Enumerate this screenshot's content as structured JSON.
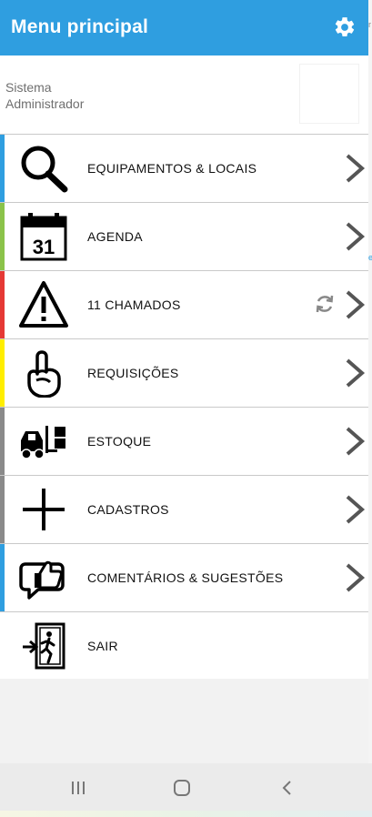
{
  "header": {
    "title": "Menu principal",
    "settings_icon": "gear-icon",
    "color": "#2f9ee0"
  },
  "user": {
    "line1": "Sistema",
    "line2": "Administrador"
  },
  "side_fragments": [
    "r",
    "e"
  ],
  "menu": {
    "items": [
      {
        "label": "EQUIPAMENTOS & LOCAIS",
        "icon": "search-icon",
        "accent": "#2f9ee0"
      },
      {
        "label": "AGENDA",
        "icon": "calendar-icon",
        "calendar_day": "31",
        "accent": "#8bc34a"
      },
      {
        "label": "11 CHAMADOS",
        "icon": "warning-icon",
        "accent": "#e53935",
        "secondary_icon": "sync-icon"
      },
      {
        "label": "REQUISIÇÕES",
        "icon": "raised-hand-icon",
        "accent": "#ffee00"
      },
      {
        "label": "ESTOQUE",
        "icon": "forklift-icon",
        "accent": "#8a8a8a"
      },
      {
        "label": "CADASTROS",
        "icon": "plus-icon",
        "accent": "#8a8a8a"
      },
      {
        "label": "COMENTÁRIOS & SUGESTÕES",
        "icon": "thumbs-up-comment-icon",
        "accent": "#2f9ee0"
      },
      {
        "label": "SAIR",
        "icon": "exit-icon",
        "accent": "#ffffff"
      }
    ]
  },
  "navbar": {
    "icons": [
      "recent-apps-icon",
      "home-icon",
      "back-icon"
    ]
  }
}
